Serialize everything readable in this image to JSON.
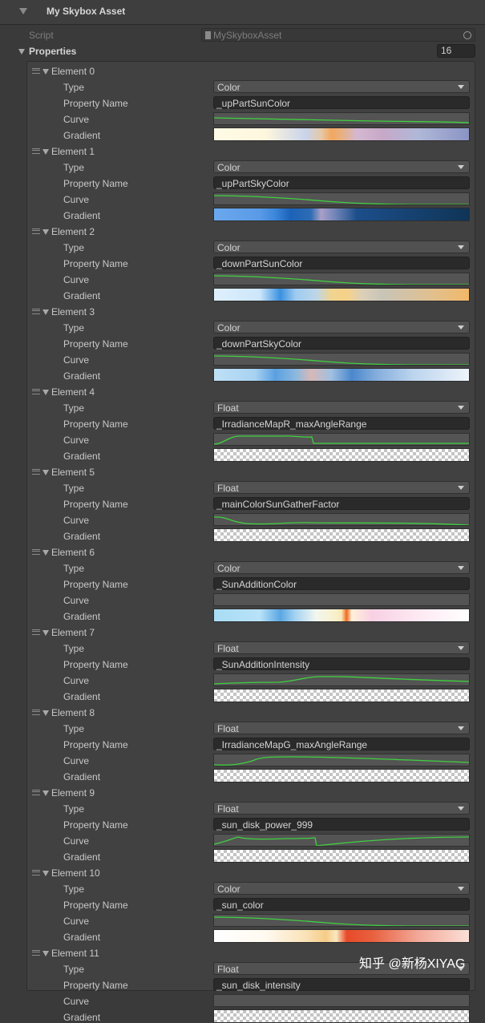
{
  "header": {
    "title": "My Skybox Asset"
  },
  "script_row": {
    "label": "Script",
    "value": "MySkyboxAsset"
  },
  "properties": {
    "label": "Properties",
    "size": "16"
  },
  "field_labels": {
    "type": "Type",
    "property_name": "Property Name",
    "curve": "Curve",
    "gradient": "Gradient"
  },
  "colors": {
    "curve_line": "#3fd13f",
    "panel_bg": "#3a3a3a"
  },
  "elements": [
    {
      "label": "Element 0",
      "type": "Color",
      "property_name": "_upPartSunColor",
      "curve": "descending-slow",
      "gradient": "linear-gradient(to right,#fffbe6 0%,#fff6de 20%,#c8d4ea 36%,#e6c8a8 42%,#f2a760 46%,#e8b080 50%,#d4b8d0 56%,#c8a8c8 66%,#b0b8d8 80%,#8a94c4 100%)"
    },
    {
      "label": "Element 1",
      "type": "Color",
      "property_name": "_upPartSkyColor",
      "curve": "descending",
      "gradient": "linear-gradient(to right,#6aa8ee 0%,#5a9ae6 18%,#3c86da 24%,#1c62b8 30%,#2e6cb4 38%,#a8a0c8 42%,#6c82b6 48%,#1c4e8a 56%,#15406e 80%,#103456 100%)"
    },
    {
      "label": "Element 2",
      "type": "Color",
      "property_name": "_downPartSunColor",
      "curve": "descending",
      "gradient": "linear-gradient(to right,#dff0fc 0%,#cce6fa 18%,#3a90e0 26%,#9ecbf0 32%,#bcd6e8 40%,#f0d490 46%,#f6d288 52%,#dcd0b8 58%,#c8c4b8 66%,#e0c090 85%,#f2b868 100%)"
    },
    {
      "label": "Element 3",
      "type": "Color",
      "property_name": "_downPartSkyColor",
      "curve": "descending",
      "gradient": "linear-gradient(to right,#bfe0f6 0%,#a8d2f2 16%,#5aa0e0 24%,#8ab8e0 32%,#d8b8b8 38%,#a0c0e0 46%,#4a88cc 54%,#86aedc 64%,#bcd4ee 78%,#eef4fa 100%)"
    },
    {
      "label": "Element 4",
      "type": "Float",
      "property_name": "_IrradianceMapR_maxAngleRange",
      "curve": "float-step",
      "gradient": "checker"
    },
    {
      "label": "Element 5",
      "type": "Float",
      "property_name": "_mainColorSunGatherFactor",
      "curve": "float-wave",
      "gradient": "checker"
    },
    {
      "label": "Element 6",
      "type": "Color",
      "property_name": "_SunAdditionColor",
      "curve": "none",
      "gradient": "linear-gradient(to right,#a8dcf4 0%,#b8e2f8 18%,#5aa6e2 26%,#a6d4f2 32%,#f2f6f0 40%,#f8f0c8 48%,#f8e8b8 50%,#ee6a20 52%,#fff0d8 54%,#f8d0e4 62%,#fde6f0 78%,#ffffff 100%)"
    },
    {
      "label": "Element 7",
      "type": "Float",
      "property_name": "_SunAdditionIntensity",
      "curve": "float-hump",
      "gradient": "checker"
    },
    {
      "label": "Element 8",
      "type": "Float",
      "property_name": "_IrradianceMapG_maxAngleRange",
      "curve": "float-rise",
      "gradient": "checker"
    },
    {
      "label": "Element 9",
      "type": "Float",
      "property_name": "_sun_disk_power_999",
      "curve": "float-dip",
      "gradient": "checker"
    },
    {
      "label": "Element 10",
      "type": "Color",
      "property_name": "_sun_color",
      "curve": "descending",
      "gradient": "linear-gradient(to right,#ffffff 0%,#fffaf0 20%,#fae2b8 36%,#f6cc88 44%,#f8e8c0 48%,#e84a2a 52%,#e8603e 62%,#f2a898 80%,#fbe0d8 100%)"
    },
    {
      "label": "Element 11",
      "type": "Float",
      "property_name": "_sun_disk_intensity",
      "curve": "none",
      "gradient": "checker"
    }
  ],
  "watermark": "知乎 @新杨XIYAG"
}
